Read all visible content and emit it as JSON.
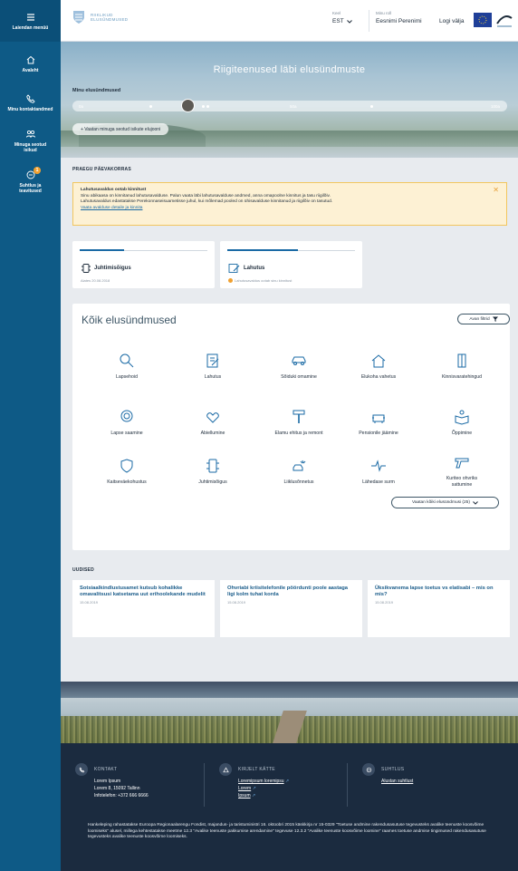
{
  "sidebar": {
    "menu_label": "Laiendan menüü",
    "items": [
      {
        "label": "Avaleht",
        "icon": "home-icon"
      },
      {
        "label": "Minu kontaktandmed",
        "icon": "phone-icon"
      },
      {
        "label": "Minuga seotud isikud",
        "icon": "people-icon"
      },
      {
        "label": "Suhtlus ja teavitused",
        "icon": "chat-icon",
        "badge": "1"
      }
    ]
  },
  "header": {
    "logo_line1": "RIIKLIKUD",
    "logo_line2": "ELUSÜNDMUSED",
    "lang_label": "Keel",
    "lang_value": "EST",
    "user_label": "Minu roll",
    "user_value": "Eesnimi Perenimi",
    "logout": "Logi välja"
  },
  "hero": {
    "title": "Riigiteenused läbi elusündmuste",
    "life_label": "Minu elusündmused",
    "timeline_labels": [
      "0a",
      "50a",
      "100a"
    ],
    "related_button": "+ Vaatan minuga seotud isikute elujooni"
  },
  "today": {
    "label": "PRAEGU PÄEVAKORRAS",
    "alert_title": "Lahutusavaldus ootab kinnitust",
    "alert_line1": "Sinu abikaasa on kinnitanud lahutusavalduse. Palun vaata läbi lahutusavalduse andmed, anna omapoolne kinnitus ja tasu riigilõiv.",
    "alert_line2": "Lahutusavaldus edastatakse Perekonnaseisuametisse juhul, kui mõlemad pooled on ühisavalduse kinnitanud ja riigilõiv on tasutud.",
    "alert_link": "Vaata avalduse detaile ja kinnita",
    "cards": [
      {
        "title": "Juhtimisõigus",
        "sub": "Alates 20.08.2018",
        "progress": 0.35,
        "icon": "license-icon"
      },
      {
        "title": "Lahutus",
        "sub": "Lahutusavaldus ootab sinu kinnitust",
        "progress": 0.55,
        "icon": "document-edit-icon"
      }
    ]
  },
  "events": {
    "title": "Kõik elusündmused",
    "filter": "Avan filtrid",
    "items": [
      {
        "label": "Lapsehoid",
        "icon": "search-magnifier-icon"
      },
      {
        "label": "Lahutus",
        "icon": "document-edit-icon"
      },
      {
        "label": "Sõiduki omamine",
        "icon": "car-icon"
      },
      {
        "label": "Elukoha vahetus",
        "icon": "house-icon"
      },
      {
        "label": "Kinnisvaratehingud",
        "icon": "building-icon"
      },
      {
        "label": "Lapse saamine",
        "icon": "baby-icon"
      },
      {
        "label": "Abiellumine",
        "icon": "hearts-icon"
      },
      {
        "label": "Elamu ehitus ja remont",
        "icon": "paint-roller-icon"
      },
      {
        "label": "Pensionile jäämine",
        "icon": "armchair-icon"
      },
      {
        "label": "Õppimine",
        "icon": "book-reader-icon"
      },
      {
        "label": "Kaitseväekohustus",
        "icon": "shield-icon"
      },
      {
        "label": "Juhtimisõigus",
        "icon": "license-icon"
      },
      {
        "label": "Liiklusõnnetus",
        "icon": "car-crash-icon"
      },
      {
        "label": "Lähedase surm",
        "icon": "heartbeat-icon"
      },
      {
        "label": "Kuriteo ohvriks sattumine",
        "icon": "gun-icon"
      }
    ],
    "show_all": "Vaatan kõiki elusündmusi (25)"
  },
  "news": {
    "label": "UUDISED",
    "items": [
      {
        "title": "Sotsiaalkindlustusamet kutsub kohalikke omavalitsusi katsetama uut erihoolekande mudelit",
        "date": "15.08.2019"
      },
      {
        "title": "Ohvriabi kriisitelefonile pöördunti poole aastaga ligi kolm tuhat korda",
        "date": "15.08.2019"
      },
      {
        "title": "Üksikvanema lapse toetus vs elatisabi – mis on mis?",
        "date": "15.08.2019"
      }
    ]
  },
  "footer": {
    "contact_title": "KONTAKT",
    "contact_lines": [
      "Lorem Ipsum",
      "Lorem 8, 15092 Tallinn",
      "Infotelefon: +372 666 6666"
    ],
    "write_title": "KIRJELT KÄTTE",
    "write_links": [
      "Loremipsum loremipsu",
      "Lorem",
      "Ipsum"
    ],
    "chat_title": "SUHTLUS",
    "chat_link": "Alustan suhtlust",
    "note": "Hankeleping rahastatakse Euroopa Regionaalarengu Fondist, majandus- ja taristuministri 16. oktoobri 2015 käskkirja nr 15-0329 \"Toetuse andmine rakendusasutuse tegevusteks avalike teenuste koosvõime loomiseks\" alusel, millega kehtestatakse meetme 12.3 \"Avalike teenuste pakkumise arendamine\" tegevuse 12.3.2 \"Avalike teenuste koosvõime loomine\" raames toetuse andmise tingimused rakendusasutuse tegevusteks avalike teenuste koosvõime loomiseks."
  },
  "colors": {
    "sidebar": "#0e5a86",
    "accent": "#1a6aa5",
    "alert_bg": "#fdf1d4",
    "footer": "#1b2b3f"
  }
}
